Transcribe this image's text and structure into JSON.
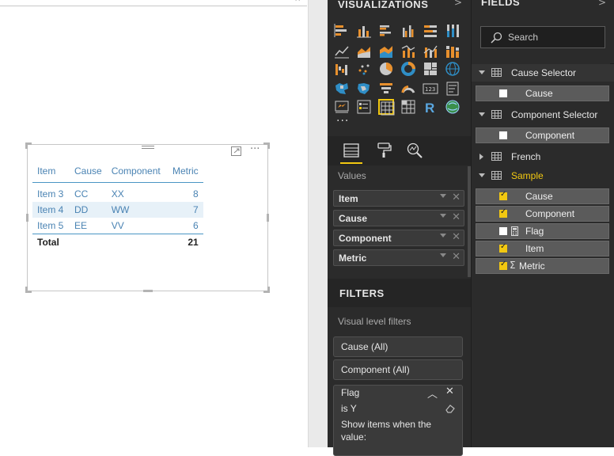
{
  "visual": {
    "columns": [
      "Item",
      "Cause",
      "Component",
      "Metric"
    ],
    "rows": [
      {
        "item": "Item 3",
        "cause": "CC",
        "component": "XX",
        "metric": "8"
      },
      {
        "item": "Item 4",
        "cause": "DD",
        "component": "WW",
        "metric": "7"
      },
      {
        "item": "Item 5",
        "cause": "EE",
        "component": "VV",
        "metric": "6"
      }
    ],
    "total_label": "Total",
    "total_value": "21",
    "more_label": "···"
  },
  "visualizations": {
    "title": "VISUALIZATIONS",
    "chevron": ">",
    "more_label": "···",
    "r_label": "R",
    "values_label": "Values",
    "wells": [
      "Item",
      "Cause",
      "Component",
      "Metric"
    ],
    "icon_names": [
      "stacked-bar-icon",
      "stacked-column-icon",
      "clustered-bar-icon",
      "clustered-column-icon",
      "100-bar-icon",
      "100-column-icon",
      "line-chart-icon",
      "area-chart-icon",
      "stacked-area-icon",
      "line-column-icon",
      "line-column-2-icon",
      "ribbon-chart-icon",
      "waterfall-icon",
      "scatter-icon",
      "pie-icon",
      "donut-icon",
      "treemap-icon",
      "map-icon",
      "filled-map-icon",
      "shape-map-icon",
      "funnel-icon",
      "gauge-icon",
      "card-icon",
      "multi-row-card-icon",
      "kpi-icon",
      "slicer-icon",
      "table-icon",
      "matrix-icon",
      "r-script-icon",
      "arcgis-icon"
    ]
  },
  "filters": {
    "title": "FILTERS",
    "section_label": "Visual level filters",
    "items": [
      "Cause  (All)",
      "Component  (All)"
    ],
    "flag": {
      "name": "Flag",
      "condition": "is Y",
      "show_items_line1": "Show items when the",
      "show_items_line2": "value:"
    }
  },
  "fields": {
    "title": "FIELDS",
    "chevron": ">",
    "search_placeholder": "Search",
    "tables": [
      {
        "name": "Cause Selector",
        "fields": [
          {
            "name": "Cause"
          }
        ]
      },
      {
        "name": "Component Selector",
        "fields": [
          {
            "name": "Component"
          }
        ]
      },
      {
        "name": "French"
      },
      {
        "name": "Sample",
        "fields": [
          {
            "name": "Cause"
          },
          {
            "name": "Component"
          },
          {
            "name": "Flag"
          },
          {
            "name": "Item"
          },
          {
            "name": "Metric"
          }
        ]
      }
    ]
  },
  "colors": {
    "accent": "#f2c811",
    "table_text": "#4a83b3",
    "pane_bg": "#2b2b2b"
  }
}
